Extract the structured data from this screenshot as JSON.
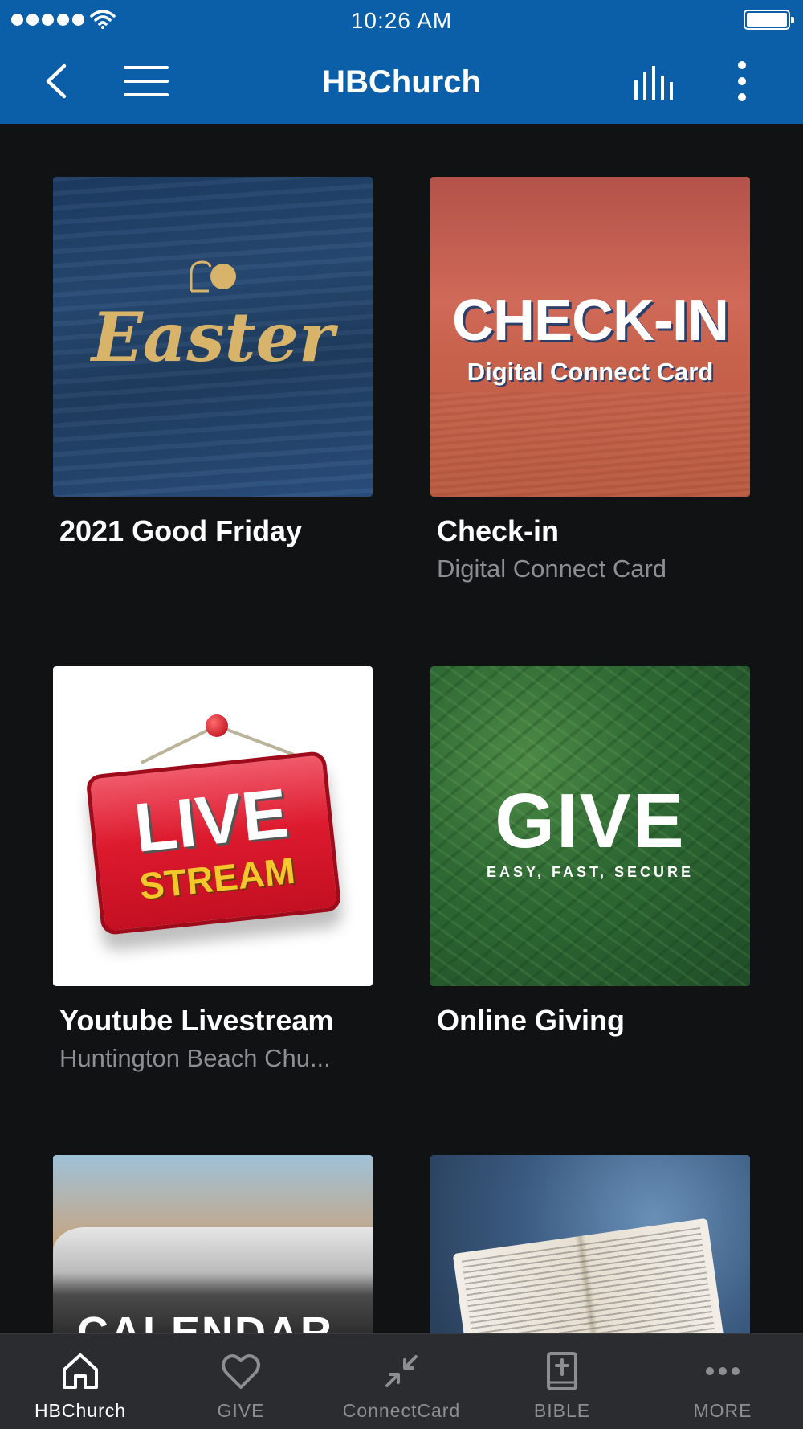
{
  "status_bar": {
    "time": "10:26 AM"
  },
  "nav": {
    "title": "HBChurch"
  },
  "tiles": [
    {
      "title": "2021 Good Friday",
      "subtitle": "",
      "artwork_text": "Easter"
    },
    {
      "title": "Check-in",
      "subtitle": "Digital Connect Card",
      "artwork_text": "CHECK-IN",
      "artwork_subtext": "Digital Connect Card"
    },
    {
      "title": "Youtube Livestream",
      "subtitle": "Huntington Beach Chu...",
      "artwork_text": "LIVE",
      "artwork_subtext": "STREAM"
    },
    {
      "title": "Online Giving",
      "subtitle": "",
      "artwork_text": "GIVE",
      "artwork_subtext": "EASY, FAST, SECURE"
    },
    {
      "artwork_text": "CALENDAR"
    },
    {
      "artwork_text": ""
    }
  ],
  "tabbar": {
    "items": [
      {
        "label": "HBChurch",
        "icon": "home-icon",
        "active": true
      },
      {
        "label": "GIVE",
        "icon": "heart-icon",
        "active": false
      },
      {
        "label": "ConnectCard",
        "icon": "collapse-arrows-icon",
        "active": false
      },
      {
        "label": "BIBLE",
        "icon": "bible-icon",
        "active": false
      },
      {
        "label": "MORE",
        "icon": "more-horizontal-icon",
        "active": false
      }
    ]
  },
  "colors": {
    "nav_background": "#0b5ea8",
    "page_background": "#111214",
    "tabbar_background": "#2b2c30",
    "subtitle_gray": "#8d8e92"
  }
}
